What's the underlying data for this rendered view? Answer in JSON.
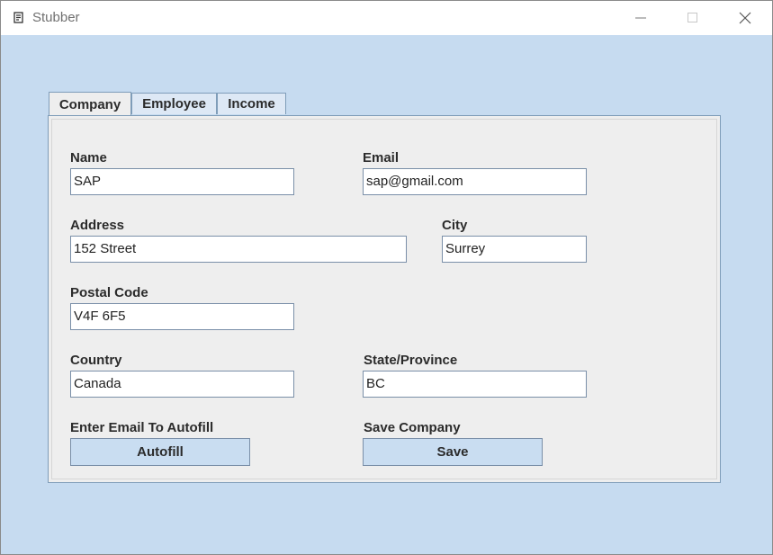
{
  "window": {
    "title": "Stubber"
  },
  "tabs": [
    {
      "label": "Company",
      "active": true
    },
    {
      "label": "Employee",
      "active": false
    },
    {
      "label": "Income",
      "active": false
    }
  ],
  "form": {
    "name": {
      "label": "Name",
      "value": "SAP"
    },
    "email": {
      "label": "Email",
      "value": "sap@gmail.com"
    },
    "address": {
      "label": "Address",
      "value": "152 Street"
    },
    "city": {
      "label": "City",
      "value": "Surrey"
    },
    "postal_code": {
      "label": "Postal Code",
      "value": "V4F 6F5"
    },
    "country": {
      "label": "Country",
      "value": "Canada"
    },
    "state": {
      "label": "State/Province",
      "value": "BC"
    },
    "autofill": {
      "label": "Enter Email To Autofill",
      "button": "Autofill"
    },
    "save": {
      "label": "Save Company",
      "button": "Save"
    }
  },
  "colors": {
    "background": "#c6dbf0",
    "panel": "#eeeeee",
    "button": "#c9ddf1",
    "border": "#7f9db9"
  },
  "icons": [
    "app-icon",
    "minimize-icon",
    "maximize-icon",
    "close-icon"
  ]
}
